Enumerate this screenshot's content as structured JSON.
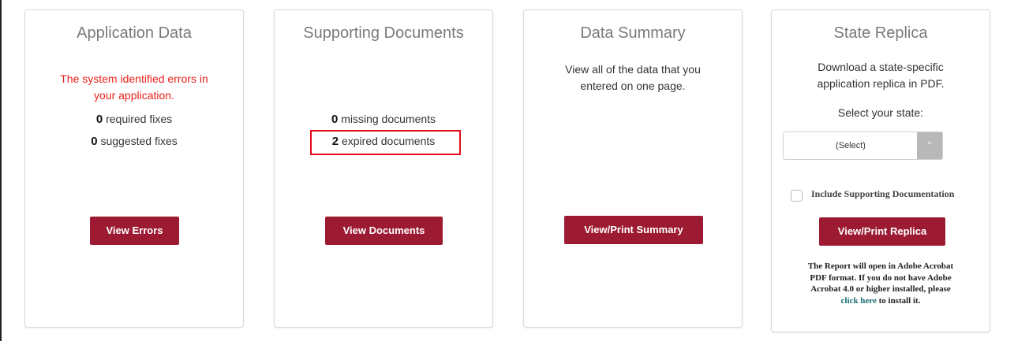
{
  "application_data": {
    "title": "Application Data",
    "error_line1": "The system identified errors in",
    "error_line2": "your application.",
    "required_count": "0",
    "required_label": " required fixes",
    "suggested_count": "0",
    "suggested_label": " suggested fixes",
    "button": "View Errors"
  },
  "supporting_documents": {
    "title": "Supporting Documents",
    "missing_count": "0",
    "missing_label": " missing documents",
    "expired_count": "2",
    "expired_label": " expired documents",
    "button": "View Documents"
  },
  "data_summary": {
    "title": "Data Summary",
    "desc_line1": "View all of the data that you",
    "desc_line2": "entered on one page.",
    "button": "View/Print Summary"
  },
  "state_replica": {
    "title": "State Replica",
    "desc_line1": "Download a state-specific",
    "desc_line2": "application replica in PDF.",
    "select_label": "Select your state:",
    "select_value": "(Select)",
    "checkbox_label": "Include Supporting Documentation",
    "button": "View/Print Replica",
    "note_line1": "The Report will open in Adobe Acrobat",
    "note_line2": "PDF format. If you do not have Adobe",
    "note_line3": "Acrobat 4.0 or higher installed, please",
    "note_link": "click here",
    "note_tail": " to install it."
  },
  "colors": {
    "button": "#9d1b32",
    "error_text": "#e8211c",
    "highlight_box": "#e00a1a",
    "link": "#1a6e72"
  }
}
